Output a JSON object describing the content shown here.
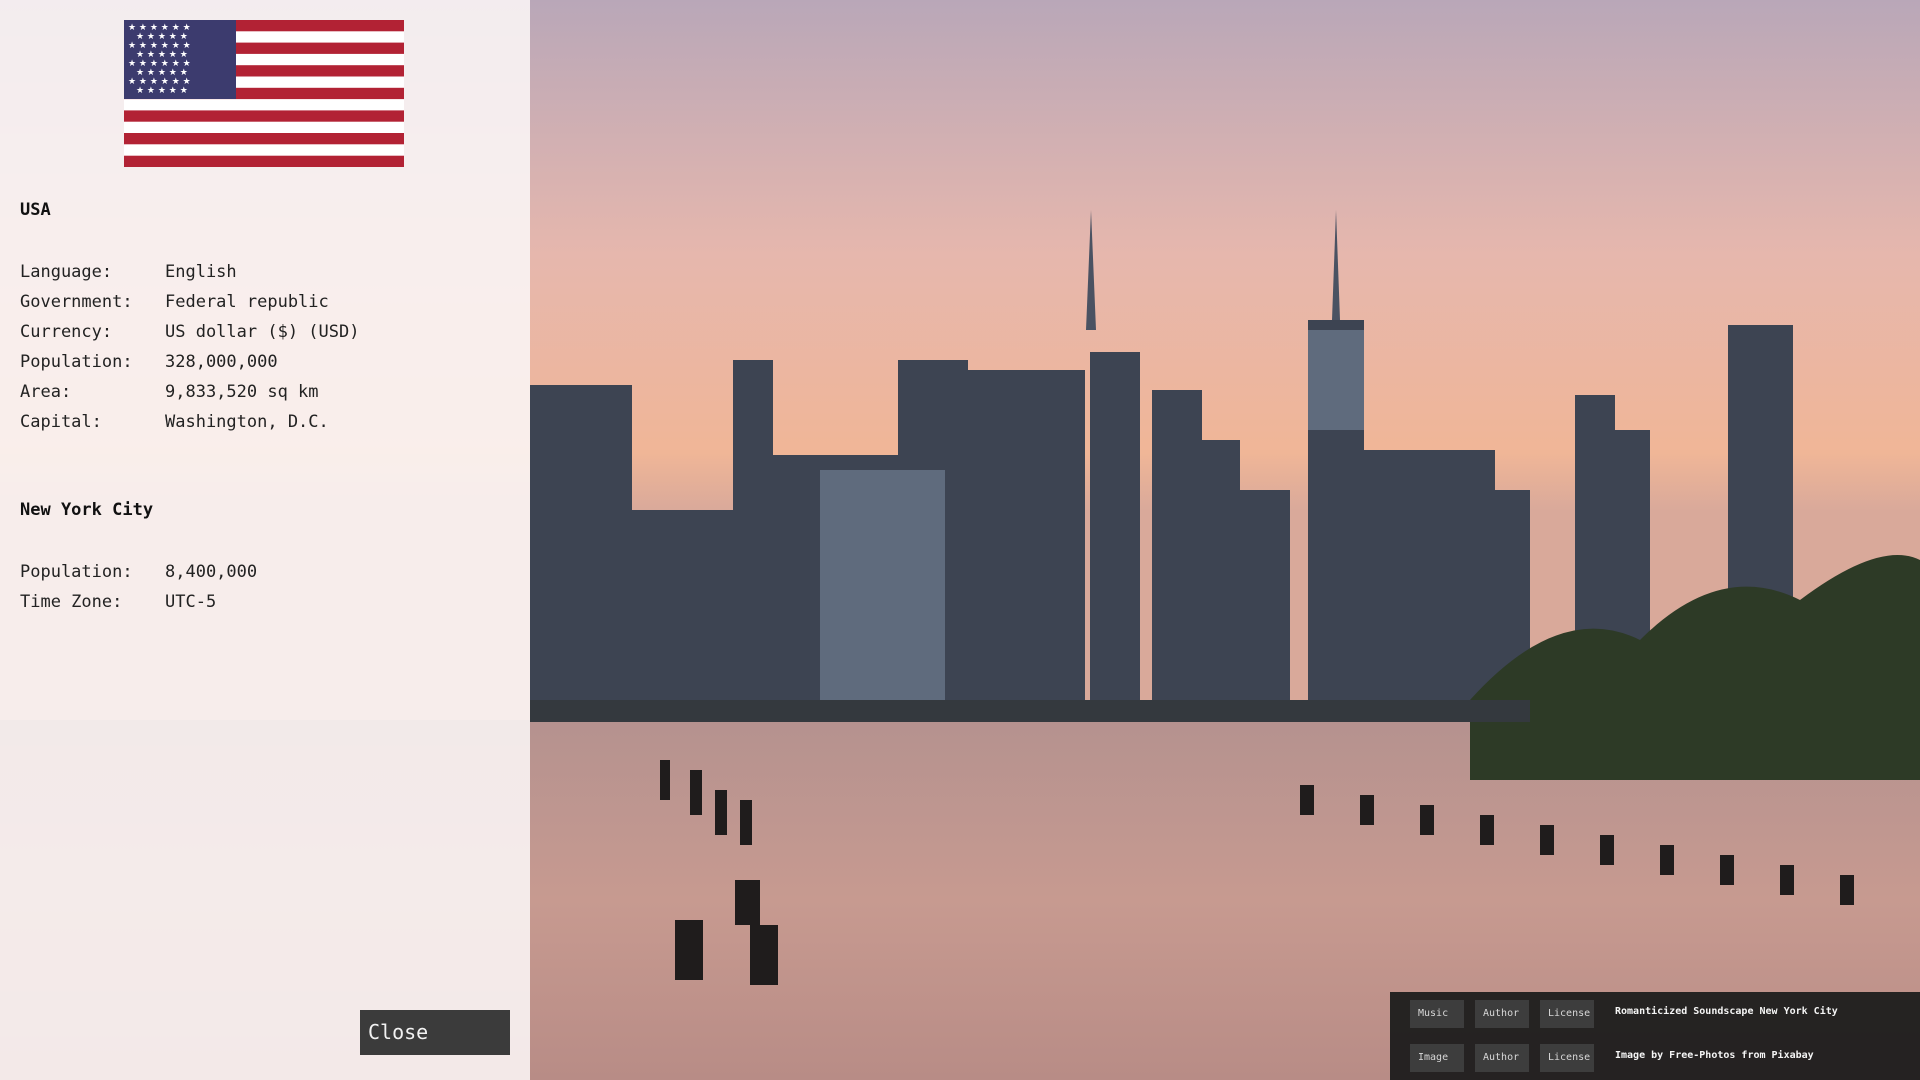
{
  "country": {
    "title": "USA",
    "flag_icon": "us-flag-icon",
    "rows": [
      {
        "label": "Language:",
        "value": "English"
      },
      {
        "label": "Government:",
        "value": "Federal republic"
      },
      {
        "label": "Currency:",
        "value": "US dollar ($) (USD)"
      },
      {
        "label": "Population:",
        "value": "328,000,000"
      },
      {
        "label": "Area:",
        "value": "9,833,520 sq km"
      },
      {
        "label": "Capital:",
        "value": "Washington, D.C."
      }
    ]
  },
  "city": {
    "title": "New York City",
    "rows": [
      {
        "label": "Population:",
        "value": "8,400,000"
      },
      {
        "label": "Time Zone:",
        "value": "UTC-5"
      }
    ]
  },
  "close_label": "Close",
  "credits": {
    "music": {
      "type": "Music",
      "author": "Author",
      "license": "License",
      "text": "Romanticized Soundscape New York City"
    },
    "image": {
      "type": "Image",
      "author": "Author",
      "license": "License",
      "text": "Image by Free-Photos from Pixabay"
    }
  },
  "colors": {
    "flag_red": "#b22234",
    "flag_blue": "#3c3b6e",
    "panel_bg": "#faf6f6",
    "button_bg": "#3b3b3b"
  }
}
